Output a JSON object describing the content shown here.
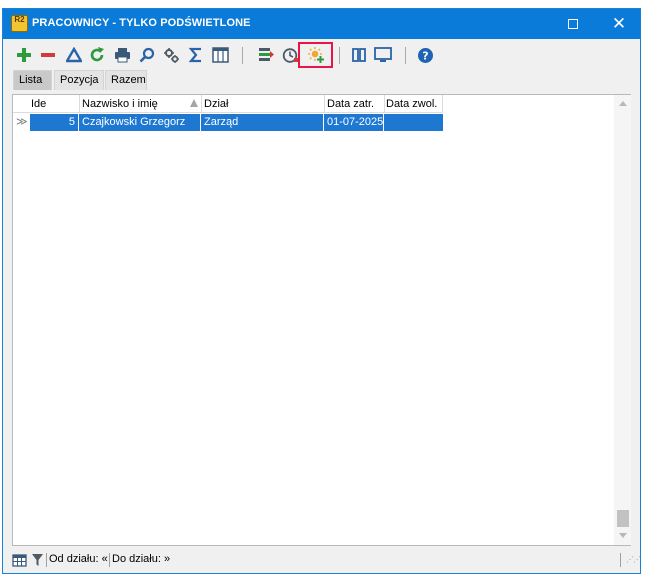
{
  "window": {
    "title": "PRACOWNICY - TYLKO PODŚWIETLONE",
    "app_icon_text": "R2"
  },
  "toolbar": {
    "buttons": [
      {
        "name": "add-icon"
      },
      {
        "name": "remove-icon"
      },
      {
        "name": "edit-triangle-icon"
      },
      {
        "name": "refresh-icon"
      },
      {
        "name": "print-icon"
      },
      {
        "name": "search-icon"
      },
      {
        "name": "settings-icon"
      },
      {
        "name": "sum-icon"
      },
      {
        "name": "columns-icon"
      },
      {
        "name": "highlight-rows-icon"
      },
      {
        "name": "history-clock-icon"
      },
      {
        "name": "add-highlight-icon"
      },
      {
        "name": "split-view-icon"
      },
      {
        "name": "monitor-icon"
      },
      {
        "name": "help-icon"
      }
    ]
  },
  "tabs": [
    "Lista",
    "Pozycja",
    "Razem"
  ],
  "grid": {
    "columns": [
      "Ide",
      "Nazwisko i imię",
      "Dział",
      "Data zatr.",
      "Data zwol."
    ],
    "sort_column": "Dział",
    "rows": [
      {
        "id": "5",
        "name": "Czajkowski Grzegorz",
        "department": "Zarząd",
        "hired": "01-07-2025",
        "fired": ""
      }
    ]
  },
  "status": {
    "from_dept": "Od działu: «",
    "to_dept": "Do działu: »"
  },
  "colors": {
    "title_bar": "#0a7bd8",
    "selection": "#1e78d2",
    "highlight_frame": "#e8154b"
  }
}
